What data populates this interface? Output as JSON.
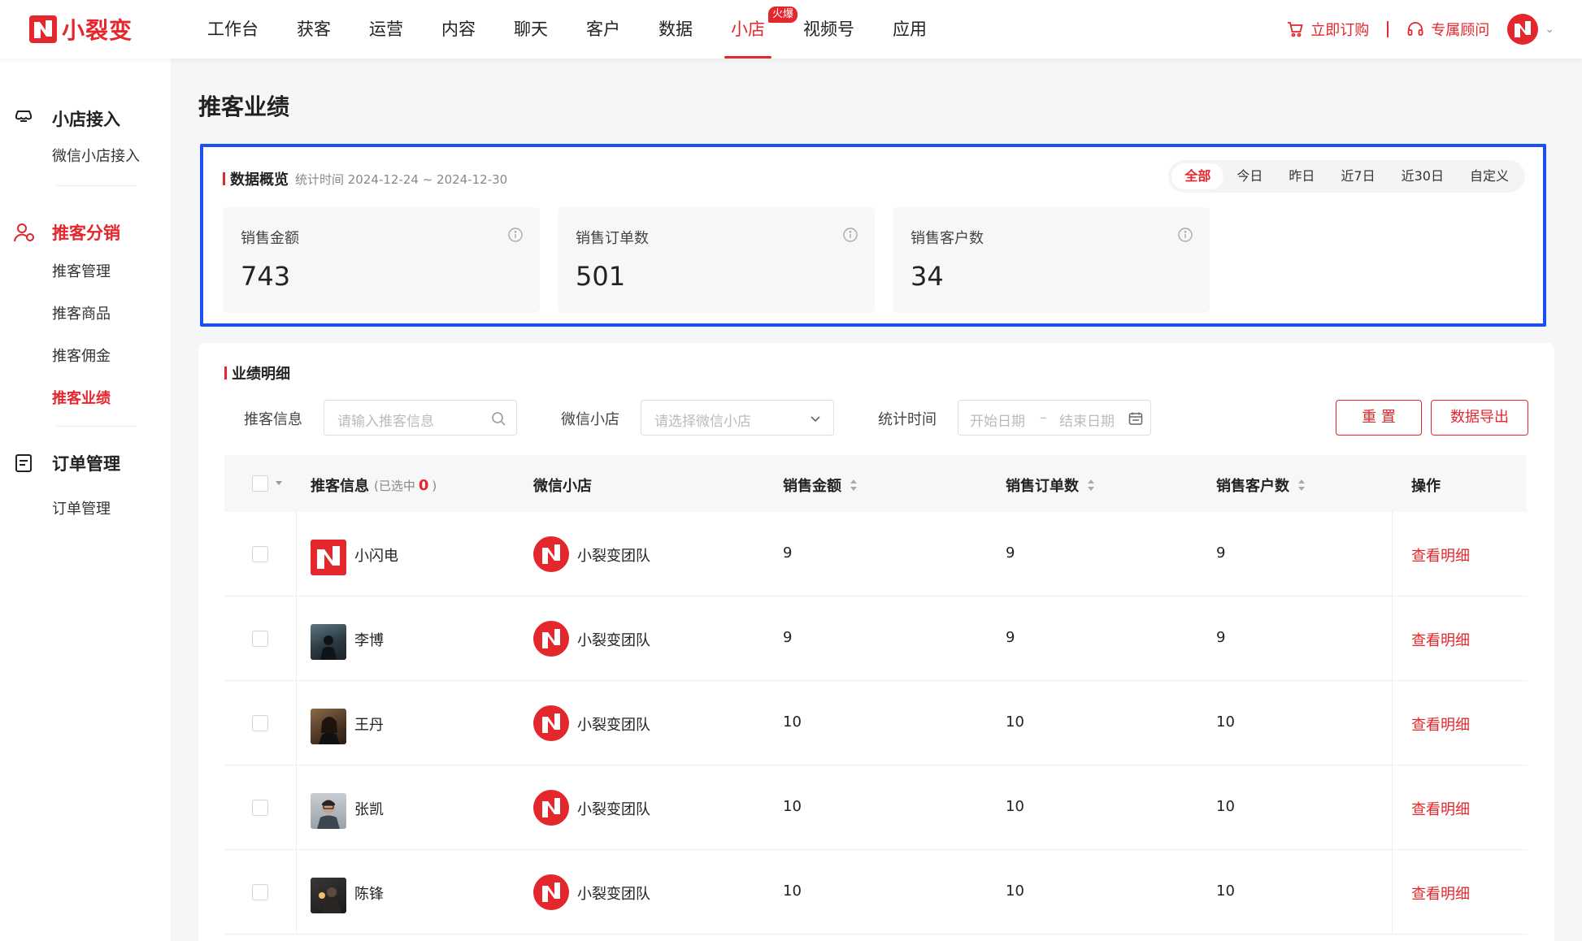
{
  "header": {
    "logo_text": "小裂变",
    "nav": [
      "工作台",
      "获客",
      "运营",
      "内容",
      "聊天",
      "客户",
      "数据",
      "小店",
      "视频号",
      "应用"
    ],
    "active_nav": "小店",
    "hot_badge": "火爆",
    "order_now": "立即订购",
    "advisor": "专属顾问",
    "accent_color": "#e4262d"
  },
  "sidebar": {
    "groups": [
      {
        "label": "小店接入",
        "icon": "shop-icon",
        "items": [
          "微信小店接入"
        ]
      },
      {
        "label": "推客分销",
        "icon": "users-icon",
        "items": [
          "推客管理",
          "推客商品",
          "推客佣金",
          "推客业绩"
        ]
      },
      {
        "label": "订单管理",
        "icon": "document-icon",
        "items": [
          "订单管理"
        ]
      }
    ],
    "active_group": "推客分销",
    "active_item": "推客业绩"
  },
  "page": {
    "title": "推客业绩"
  },
  "overview": {
    "title": "数据概览",
    "period": "统计时间 2024-12-24 ~ 2024-12-30",
    "ranges": [
      "全部",
      "今日",
      "昨日",
      "近7日",
      "近30日",
      "自定义"
    ],
    "active_range": "全部",
    "stats": [
      {
        "label": "销售金额",
        "value": "743"
      },
      {
        "label": "销售订单数",
        "value": "501"
      },
      {
        "label": "销售客户数",
        "value": "34"
      }
    ]
  },
  "detail": {
    "title": "业绩明细",
    "filters": {
      "promoter_label": "推客信息",
      "promoter_placeholder": "请输入推客信息",
      "shop_label": "微信小店",
      "shop_placeholder": "请选择微信小店",
      "time_label": "统计时间",
      "start_placeholder": "开始日期",
      "range_sep": "–",
      "end_placeholder": "结束日期"
    },
    "buttons": {
      "reset": "重 置",
      "export": "数据导出"
    },
    "columns": {
      "promoter": "推客信息",
      "selected_prefix": "(已选中",
      "selected_count": "0",
      "selected_suffix": ")",
      "shop": "微信小店",
      "amount": "销售金额",
      "orders": "销售订单数",
      "customers": "销售客户数",
      "action": "操作"
    },
    "rows": [
      {
        "name": "小闪电",
        "shop": "小裂变团队",
        "amount": "9",
        "orders": "9",
        "customers": "9",
        "action": "查看明细"
      },
      {
        "name": "李博",
        "shop": "小裂变团队",
        "amount": "9",
        "orders": "9",
        "customers": "9",
        "action": "查看明细"
      },
      {
        "name": "王丹",
        "shop": "小裂变团队",
        "amount": "10",
        "orders": "10",
        "customers": "10",
        "action": "查看明细"
      },
      {
        "name": "张凯",
        "shop": "小裂变团队",
        "amount": "10",
        "orders": "10",
        "customers": "10",
        "action": "查看明细"
      },
      {
        "name": "陈锋",
        "shop": "小裂变团队",
        "amount": "10",
        "orders": "10",
        "customers": "10",
        "action": "查看明细"
      }
    ]
  }
}
